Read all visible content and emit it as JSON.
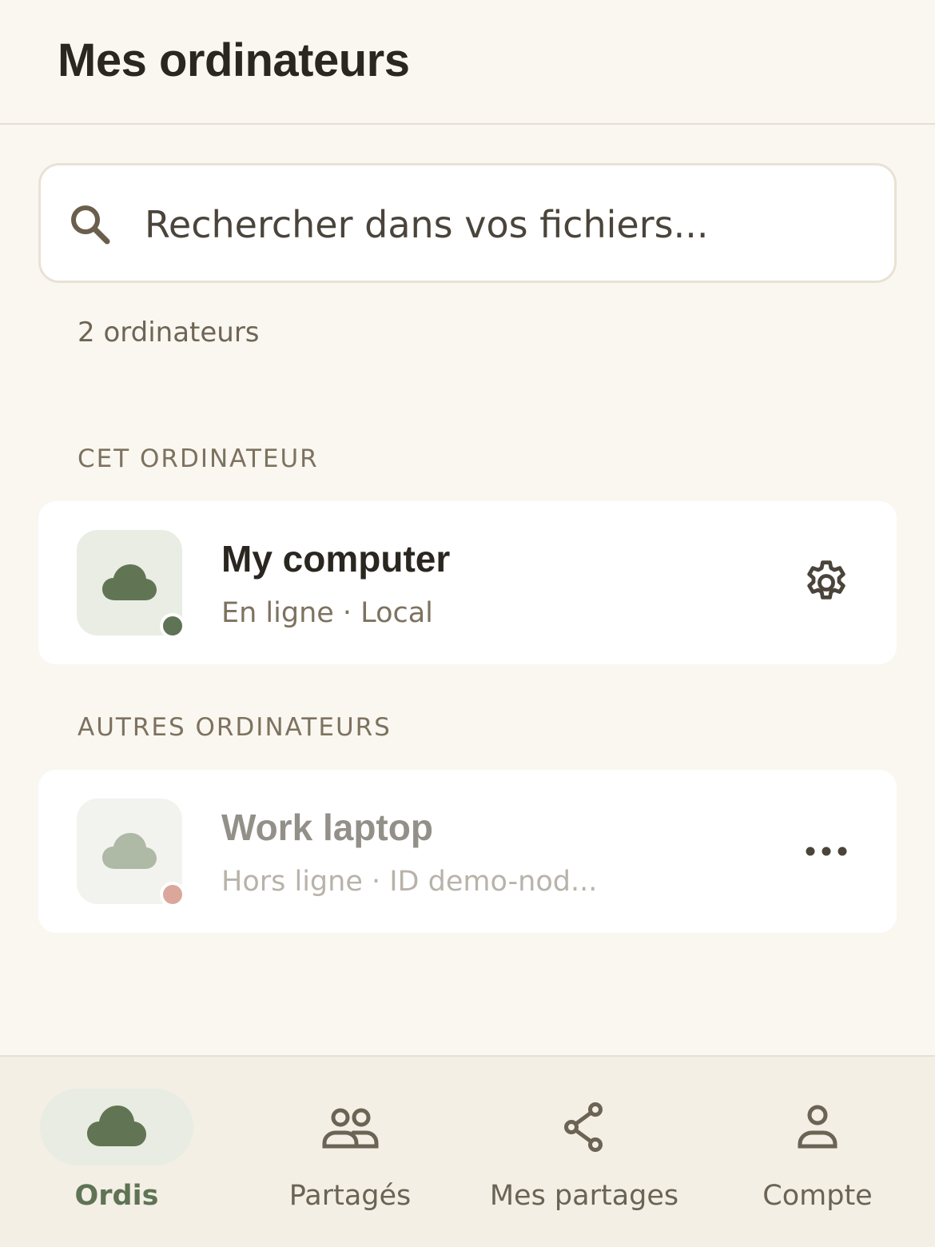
{
  "header": {
    "title": "Mes ordinateurs"
  },
  "search": {
    "placeholder": "Rechercher dans vos fichiers..."
  },
  "summary": {
    "count_text": "2 ordinateurs"
  },
  "sections": {
    "this_computer": "CET ORDINATEUR",
    "other_computers": "AUTRES ORDINATEURS"
  },
  "devices": [
    {
      "name": "My computer",
      "subtitle": "En ligne · Local",
      "status": "online",
      "action_icon": "gear-icon"
    },
    {
      "name": "Work laptop",
      "subtitle": "Hors ligne · ID demo-nod...",
      "status": "offline",
      "action_icon": "more-icon"
    }
  ],
  "nav": {
    "items": [
      {
        "label": "Ordis",
        "icon": "cloud-icon",
        "active": true
      },
      {
        "label": "Partagés",
        "icon": "users-icon",
        "active": false
      },
      {
        "label": "Mes partages",
        "icon": "share-icon",
        "active": false
      },
      {
        "label": "Compte",
        "icon": "user-icon",
        "active": false
      }
    ]
  },
  "colors": {
    "background": "#FAF7F1",
    "accent_green": "#5F7355",
    "online_dot": "#5F7355",
    "offline_dot": "#DBA79C",
    "nav_background": "#F3EFE5"
  }
}
